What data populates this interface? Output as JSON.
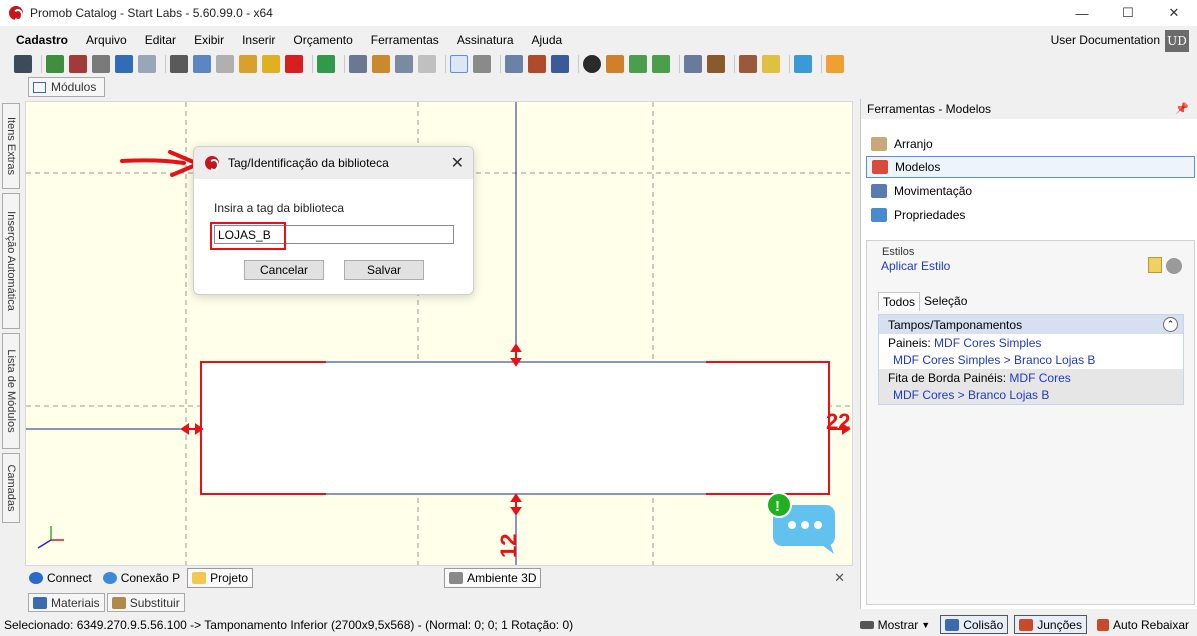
{
  "window": {
    "title": "Promob Catalog - Start Labs - 5.60.99.0 - x64",
    "minimize_glyph": "—",
    "maximize_glyph": "☐",
    "close_glyph": "✕"
  },
  "menu": [
    "Cadastro",
    "Arquivo",
    "Editar",
    "Exibir",
    "Inserir",
    "Orçamento",
    "Ferramentas",
    "Assinatura",
    "Ajuda"
  ],
  "user": {
    "label": "User Documentation",
    "initials": "UD"
  },
  "doc_tab": "Módulos",
  "left_tabs": [
    "Itens Extras",
    "Inserção Automática",
    "Lista de Módulos",
    "Camadas"
  ],
  "dialog": {
    "title": "Tag/Identificação da biblioteca",
    "close_glyph": "✕",
    "prompt": "Insira a tag da biblioteca",
    "value": "LOJAS_B",
    "cancel_label": "Cancelar",
    "save_label": "Salvar"
  },
  "dimensions": {
    "right_label": "22",
    "bottom_label": "12"
  },
  "chat_badge": "!",
  "bottom_tabs": [
    "Connect",
    "Conexão P",
    "Projeto",
    "Ambiente 3D"
  ],
  "bottom_close": "✕",
  "sub_tabs": [
    "Materiais",
    "Substituir"
  ],
  "status": {
    "text": "Selecionado: 6349.270.9.5.56.100 -> Tamponamento Inferior (2700x9,5x568) - (Normal: 0; 0; 1 Rotação: 0)",
    "mostrar": "Mostrar",
    "colisao": "Colisão",
    "juncoes": "Junções",
    "auto_rebaixar": "Auto Rebaixar"
  },
  "right_panel": {
    "title": "Ferramentas - Modelos",
    "pin_glyph": "📌",
    "nav": [
      "Arranjo",
      "Modelos",
      "Movimentação",
      "Propriedades"
    ],
    "styles_label": "Estilos",
    "apply_style": "Aplicar Estilo",
    "tabs": [
      "Todos",
      "Seleção"
    ],
    "category": "Tampos/Tamponamentos",
    "category_toggle": "⌃",
    "paineis_label": "Paineis:",
    "paineis_value": "MDF Cores Simples",
    "paineis_sub": "MDF Cores Simples > Branco Lojas B",
    "fita_label": "Fita de Borda Painéis:",
    "fita_value": "MDF Cores",
    "fita_sub": "MDF Cores > Branco Lojas B"
  }
}
